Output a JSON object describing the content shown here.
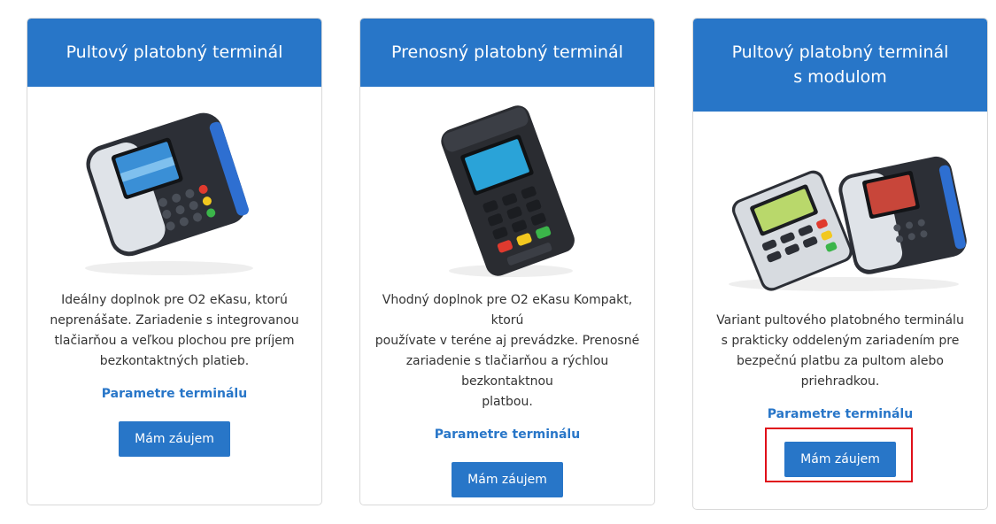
{
  "cards": [
    {
      "title_lines": [
        "Pultový platobný terminál"
      ],
      "image_icon": "countertop-terminal-image",
      "description_lines": [
        "Ideálny doplnok pre O2 eKasu, ktorú",
        "neprenášate. Zariadenie s integrovanou",
        "tlačiarňou a veľkou plochou pre príjem",
        "bezkontaktných platieb."
      ],
      "link_label": "Parametre terminálu",
      "button_label": "Mám záujem"
    },
    {
      "title_lines": [
        "Prenosný platobný terminál"
      ],
      "image_icon": "portable-terminal-image",
      "description_lines": [
        "Vhodný doplnok pre O2 eKasu Kompakt, ktorú",
        "používate v teréne aj prevádzke. Prenosné",
        "zariadenie s tlačiarňou a rýchlou bezkontaktnou",
        "platbou."
      ],
      "link_label": "Parametre terminálu",
      "button_label": "Mám záujem"
    },
    {
      "title_lines": [
        "Pultový platobný terminál",
        "s modulom"
      ],
      "image_icon": "terminal-with-module-image",
      "description_lines": [
        "Variant pultového platobného terminálu",
        "s prakticky oddeleným zariadením pre",
        "bezpečnú platbu za pultom alebo priehradkou."
      ],
      "link_label": "Parametre terminálu",
      "button_label": "Mám záujem",
      "highlighted": true
    }
  ],
  "colors": {
    "accent": "#2876c8",
    "highlight": "#e0101a"
  }
}
